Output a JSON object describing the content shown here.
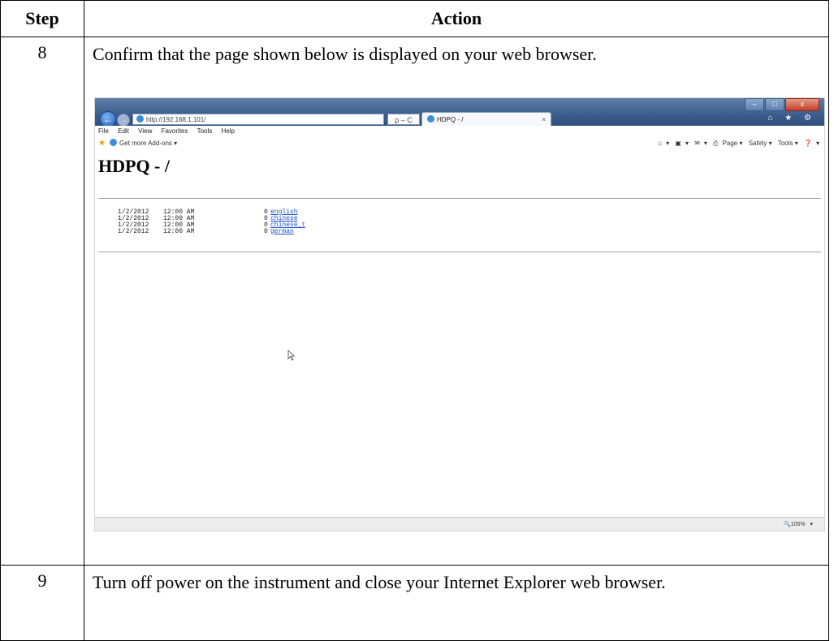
{
  "table": {
    "header_step": "Step",
    "header_action": "Action",
    "rows": [
      {
        "step": "8",
        "action": "Confirm that the page shown below is displayed on your web browser."
      },
      {
        "step": "9",
        "action": "Turn off power on the instrument and close your Internet Explorer web browser."
      }
    ]
  },
  "browser": {
    "address": "http://192.168.1.101/",
    "addr_tools": "ρ – C",
    "tab_title": "HDPQ - /",
    "tab_close": "×",
    "window_buttons": {
      "minimize": "–",
      "maximize": "□",
      "close": "x"
    },
    "right_icons": "⌂ ★ ⚙",
    "menu": [
      "File",
      "Edit",
      "View",
      "Favorites",
      "Tools",
      "Help"
    ],
    "favorites_addons": "Get more Add-ons ▾",
    "command_bar": [
      "▾",
      "▾",
      "▾",
      "Page ▾",
      "Safety ▾",
      "Tools ▾",
      "▾"
    ],
    "page_heading": "HDPQ - /",
    "listing": [
      {
        "date": "1/2/2012",
        "time": "12:00 AM",
        "size": "0",
        "name": "english"
      },
      {
        "date": "1/2/2012",
        "time": "12:00 AM",
        "size": "0",
        "name": "chinese"
      },
      {
        "date": "1/2/2012",
        "time": "12:00 AM",
        "size": "0",
        "name": "chinese_t"
      },
      {
        "date": "1/2/2012",
        "time": "12:00 AM",
        "size": "0",
        "name": "german"
      }
    ],
    "zoom": "105%",
    "zoom_arrow": "▾"
  },
  "colors": {
    "titlebar": "#3c5d8c",
    "link": "#1a4fd0",
    "close_button": "#c2402a"
  }
}
